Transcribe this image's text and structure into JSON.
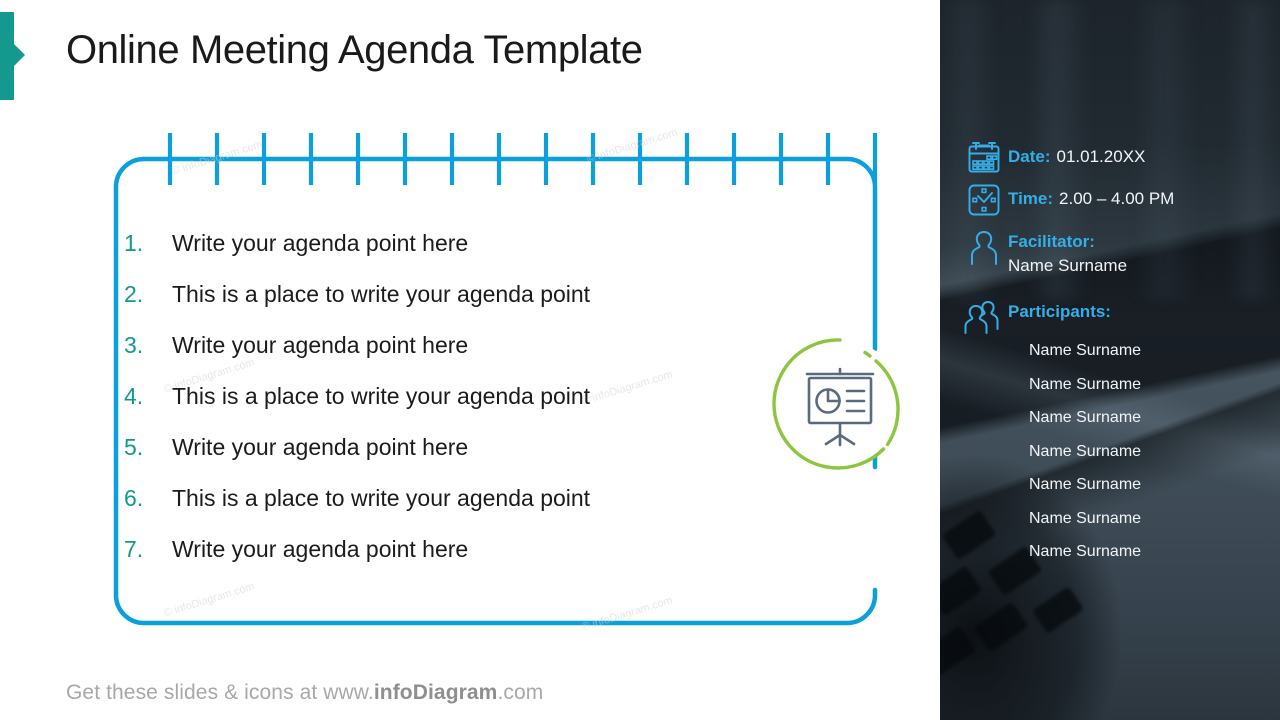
{
  "slide": {
    "title": "Online Meeting Agenda Template",
    "footer_prefix": "Get these slides & icons at www.",
    "footer_brand": "infoDiagram",
    "footer_suffix": ".com",
    "watermark": "© infoDiagram.com"
  },
  "colors": {
    "accent_teal": "#14998F",
    "number_teal": "#12998D",
    "notebook_blue": "#0BA0DC",
    "badge_green": "#8CC63E",
    "icon_slate": "#5A6B7D",
    "panel_label_blue": "#35AEE8",
    "panel_text": "#F2F5F7",
    "footer_grey": "#A8A8A8"
  },
  "notebook": {
    "tick_count": 16,
    "icon_name": "presentation-chart-icon"
  },
  "agenda": {
    "items": [
      {
        "number": "1.",
        "text": "Write your agenda point here"
      },
      {
        "number": "2.",
        "text": "This is a place to write your agenda point"
      },
      {
        "number": "3.",
        "text": "Write your agenda point here"
      },
      {
        "number": "4.",
        "text": "This is a place to write your agenda point"
      },
      {
        "number": "5.",
        "text": "Write your agenda point here"
      },
      {
        "number": "6.",
        "text": "This is a place to write your agenda point"
      },
      {
        "number": "7.",
        "text": "Write your agenda point here"
      }
    ]
  },
  "info_panel": {
    "date": {
      "label": "Date:",
      "value": "01.01.20XX",
      "icon": "calendar-icon"
    },
    "time": {
      "label": "Time:",
      "value": "2.00 – 4.00 PM",
      "icon": "clock-icon"
    },
    "facilitator": {
      "label": "Facilitator:",
      "value": "Name Surname",
      "icon": "person-icon"
    },
    "participants": {
      "label": "Participants:",
      "icon": "people-group-icon",
      "names": [
        "Name Surname",
        "Name Surname",
        "Name Surname",
        "Name Surname",
        "Name Surname",
        "Name Surname",
        "Name Surname"
      ]
    }
  }
}
